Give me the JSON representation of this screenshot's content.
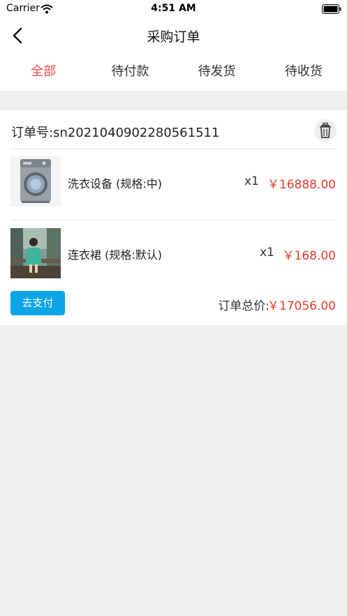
{
  "status_bar": {
    "carrier": "Carrier",
    "time": "4:51 AM"
  },
  "nav": {
    "title": "采购订单"
  },
  "tabs": [
    {
      "label": "全部",
      "active": true
    },
    {
      "label": "待付款",
      "active": false
    },
    {
      "label": "待发货",
      "active": false
    },
    {
      "label": "待收货",
      "active": false
    }
  ],
  "order": {
    "order_no": "订单号:sn2021040902280561511",
    "items": [
      {
        "name": "洗衣设备 (规格:中)",
        "qty": "x1",
        "price": "￥16888.00",
        "image": "washing-machine"
      },
      {
        "name": "连衣裙 (规格:默认)",
        "qty": "x1",
        "price": "￥168.00",
        "image": "dress"
      }
    ],
    "pay_label": "去支付",
    "total_label": "订单总价:",
    "total_value": "￥17056.00"
  },
  "colors": {
    "accent_red": "#e13a2b",
    "tab_active": "#ef4a4a",
    "pay_button": "#0ba5e8"
  }
}
